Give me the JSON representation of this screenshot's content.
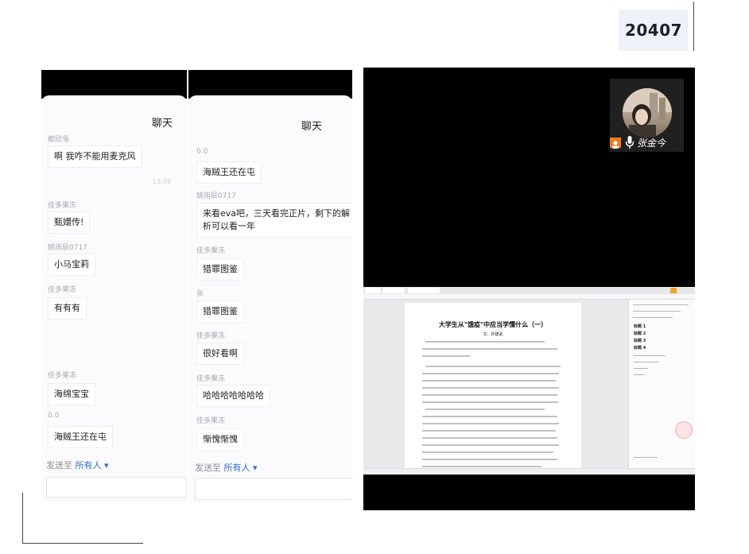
{
  "badge": {
    "text": "20407"
  },
  "chat_left": {
    "title": "聊天",
    "messages": [
      {
        "sender": "都欣雪",
        "text": "啊 我咋不能用麦克风"
      },
      {
        "sender": "佳多果冻",
        "text": "甄嬛传!"
      },
      {
        "sender": "姚雨辰0717",
        "text": "小马宝莉"
      },
      {
        "sender": "佳多果冻",
        "text": "有有有"
      },
      {
        "sender": "佳多果冻",
        "text": "海绵宝宝"
      },
      {
        "sender": "0.0",
        "text": "海贼王还在屯"
      }
    ],
    "time": "13:09",
    "send_to": {
      "prefix": "发送至",
      "target": "所有人",
      "caret": "▾"
    }
  },
  "chat_right": {
    "title": "聊天",
    "messages": [
      {
        "sender": "0.0",
        "text": "海贼王还在屯"
      },
      {
        "sender": "姚雨辰0717",
        "text": "来看eva吧，三天看完正片，剩下的解析可以看一年"
      },
      {
        "sender": "佳多果冻",
        "text": "猎罪图鉴"
      },
      {
        "sender": "张",
        "text": "猎罪图鉴"
      },
      {
        "sender": "佳多果冻",
        "text": "很好看啊"
      },
      {
        "sender": "佳多果冻",
        "text": "哈哈哈哈哈哈哈"
      },
      {
        "sender": "佳多果冻",
        "text": "惭愧惭愧"
      }
    ],
    "send_to": {
      "prefix": "发送至",
      "target": "所有人",
      "caret": "▾"
    }
  },
  "video": {
    "participant_name": "张金今",
    "shared_doc": {
      "title": "大学生从\"饿疫\"中应当学懂什么（一）",
      "author": "文：孙建武",
      "styles": [
        "标题 1",
        "标题 2",
        "标题 3",
        "标题 4"
      ]
    }
  },
  "colors": {
    "accent": "#2f6fd8",
    "camera": "#f07c1e"
  }
}
